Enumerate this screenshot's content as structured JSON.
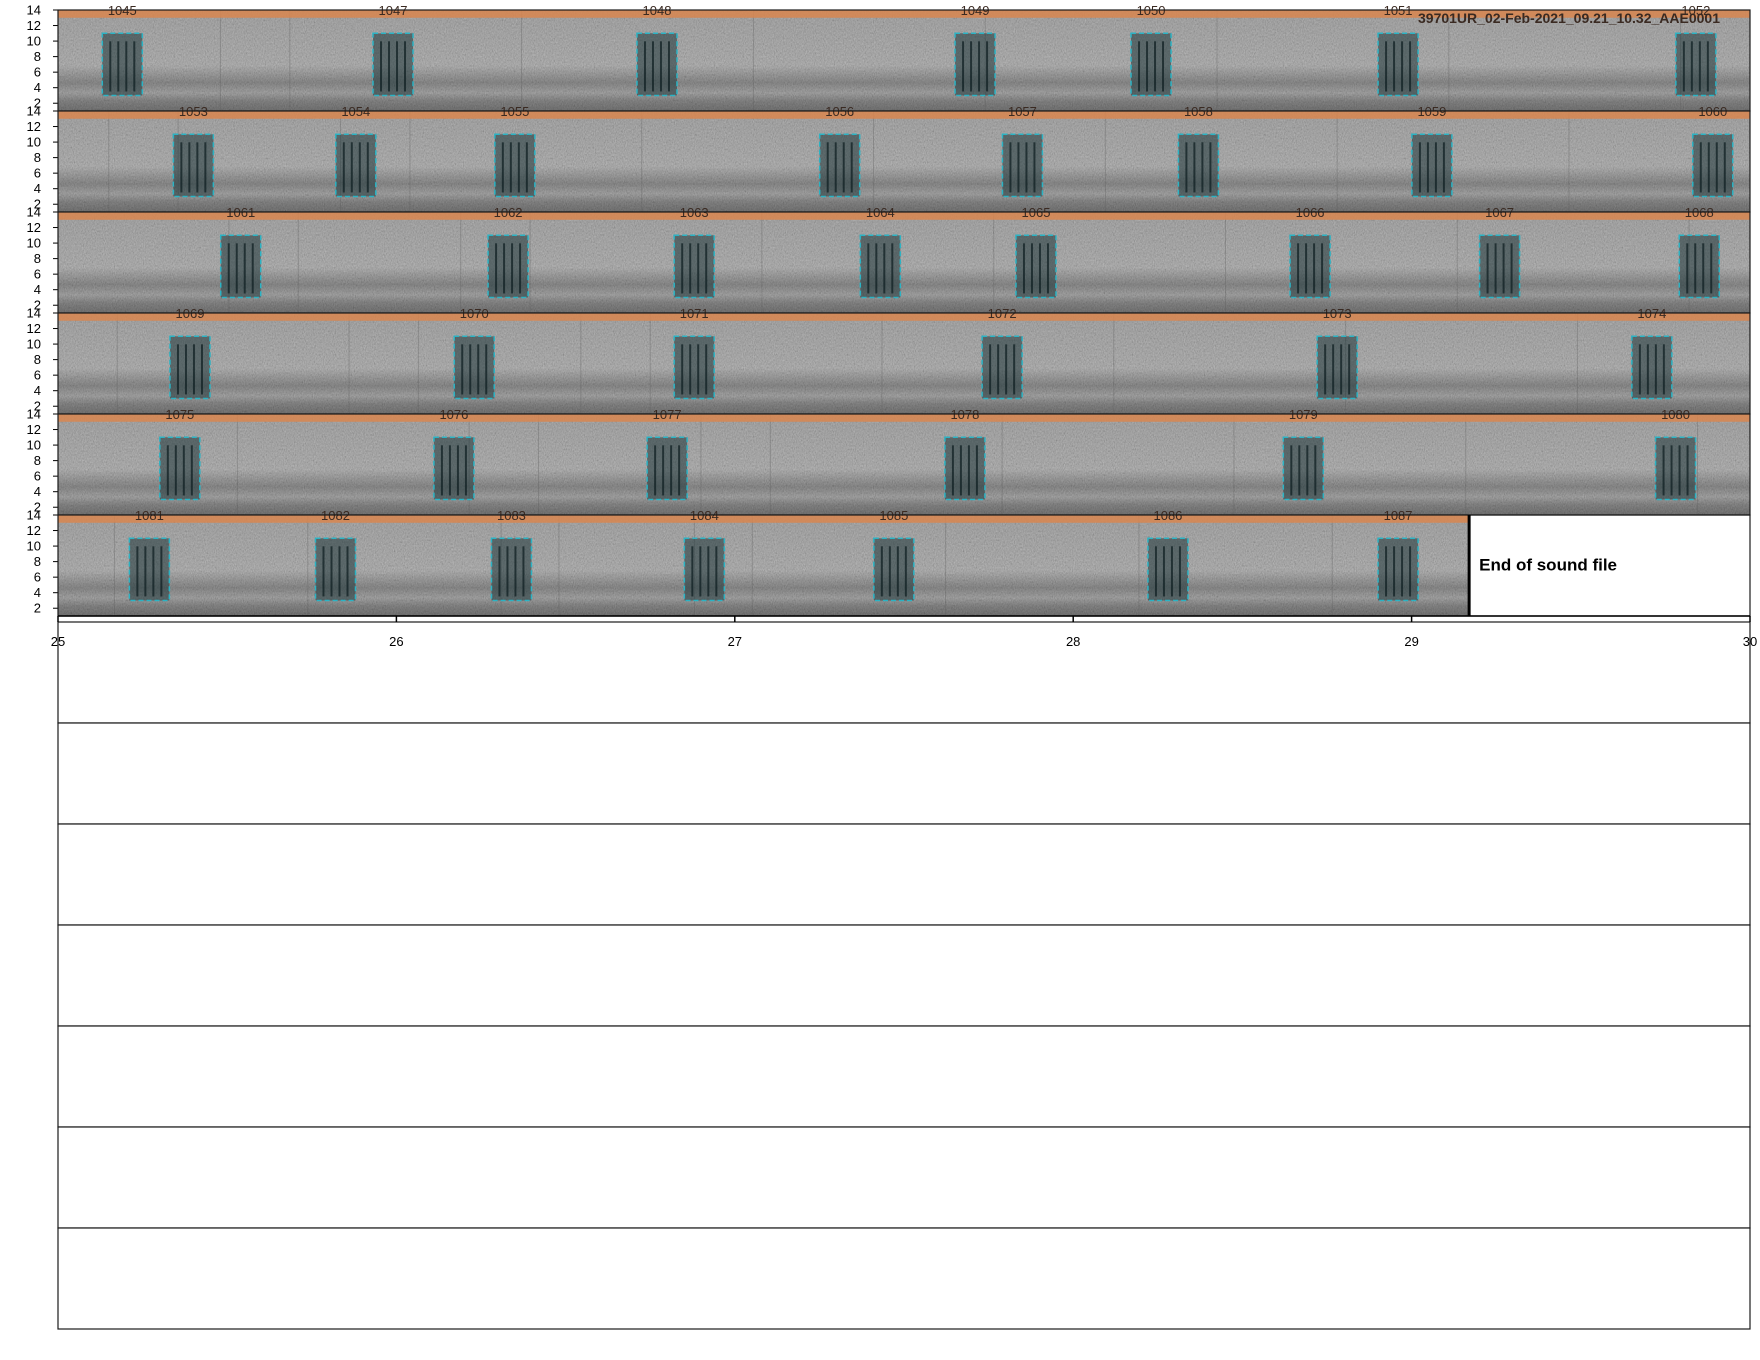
{
  "title": "39701UR_02-Feb-2021_09.21_10.32_AAE0001",
  "end_label": "End of sound file",
  "chart_data": {
    "type": "spectrogram",
    "x_range": [
      25,
      30
    ],
    "x_ticks": [
      25,
      26,
      27,
      28,
      29,
      30
    ],
    "x_tick_labels": [
      "25",
      "26",
      "27",
      "28",
      "29",
      "30"
    ],
    "y_range": [
      1,
      14
    ],
    "y_ticks": [
      2,
      4,
      6,
      8,
      10,
      12,
      14
    ],
    "y_tick_labels": [
      "2",
      "4",
      "6",
      "8",
      "10",
      "12",
      "14"
    ],
    "freq_band": [
      3,
      11
    ],
    "bar_band": [
      13,
      14
    ],
    "colors": {
      "detection_bar": "#d9864f",
      "box": "#2bb3c4",
      "spectrogram": "#8c8c8c",
      "axis": "#000000"
    },
    "filled_rows": 6,
    "empty_rows": 7,
    "end_of_file_x": 29.17,
    "rows": [
      {
        "detections": [
          {
            "id": "1045",
            "x": 25.19
          },
          {
            "id": "1047",
            "x": 25.99
          },
          {
            "id": "1048",
            "x": 26.77
          },
          {
            "id": "1049",
            "x": 27.71
          },
          {
            "id": "1050",
            "x": 28.23
          },
          {
            "id": "1051",
            "x": 28.96
          },
          {
            "id": "1052",
            "x": 29.84
          }
        ]
      },
      {
        "detections": [
          {
            "id": "1053",
            "x": 25.4
          },
          {
            "id": "1054",
            "x": 25.88
          },
          {
            "id": "1055",
            "x": 26.35
          },
          {
            "id": "1056",
            "x": 27.31
          },
          {
            "id": "1057",
            "x": 27.85
          },
          {
            "id": "1058",
            "x": 28.37
          },
          {
            "id": "1059",
            "x": 29.06
          },
          {
            "id": "1060",
            "x": 29.89
          }
        ]
      },
      {
        "detections": [
          {
            "id": "1061",
            "x": 25.54
          },
          {
            "id": "1062",
            "x": 26.33
          },
          {
            "id": "1063",
            "x": 26.88
          },
          {
            "id": "1064",
            "x": 27.43
          },
          {
            "id": "1065",
            "x": 27.89
          },
          {
            "id": "1066",
            "x": 28.7
          },
          {
            "id": "1067",
            "x": 29.26
          },
          {
            "id": "1068",
            "x": 29.85
          }
        ]
      },
      {
        "detections": [
          {
            "id": "1069",
            "x": 25.39
          },
          {
            "id": "1070",
            "x": 26.23
          },
          {
            "id": "1071",
            "x": 26.88
          },
          {
            "id": "1072",
            "x": 27.79
          },
          {
            "id": "1073",
            "x": 28.78
          },
          {
            "id": "1074",
            "x": 29.71
          }
        ]
      },
      {
        "detections": [
          {
            "id": "1075",
            "x": 25.36
          },
          {
            "id": "1076",
            "x": 26.17
          },
          {
            "id": "1077",
            "x": 26.8
          },
          {
            "id": "1078",
            "x": 27.68
          },
          {
            "id": "1079",
            "x": 28.68
          },
          {
            "id": "1080",
            "x": 29.78
          }
        ]
      },
      {
        "detections": [
          {
            "id": "1081",
            "x": 25.27
          },
          {
            "id": "1082",
            "x": 25.82
          },
          {
            "id": "1083",
            "x": 26.34
          },
          {
            "id": "1084",
            "x": 26.91
          },
          {
            "id": "1085",
            "x": 27.47
          },
          {
            "id": "1086",
            "x": 28.28
          },
          {
            "id": "1087",
            "x": 28.96
          }
        ]
      }
    ]
  }
}
